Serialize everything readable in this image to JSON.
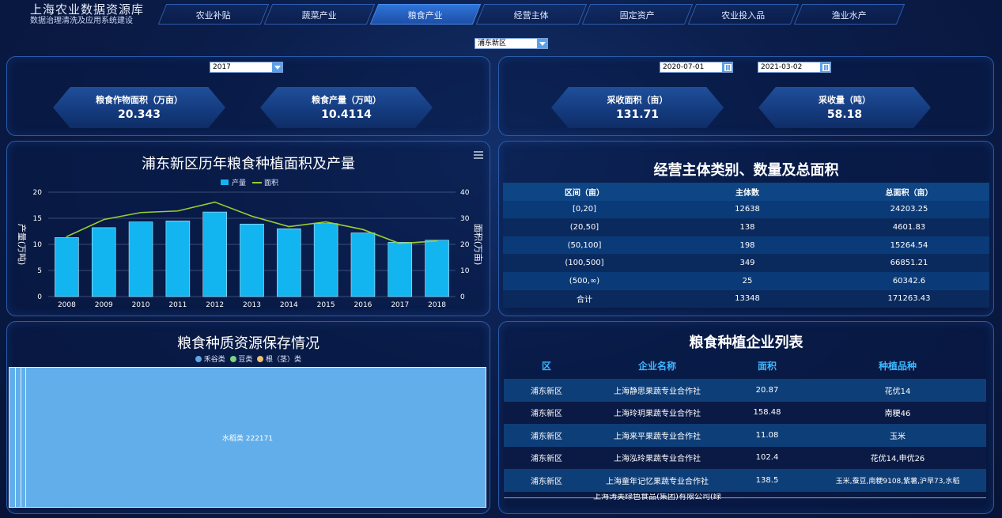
{
  "brand": {
    "title": "上海农业数据资源库",
    "subtitle": "数据治理清洗及应用系统建设"
  },
  "nav": {
    "tabs": [
      "农业补贴",
      "蔬菜产业",
      "粮食产业",
      "经营主体",
      "固定资产",
      "农业投入品",
      "渔业水产"
    ],
    "active": 2
  },
  "district_select": {
    "value": "浦东新区"
  },
  "year_select": {
    "value": "2017"
  },
  "date_from": {
    "value": "2020-07-01"
  },
  "date_to": {
    "value": "2021-03-02"
  },
  "kpis": [
    {
      "label": "粮食作物面积（万亩）",
      "value": "20.343"
    },
    {
      "label": "粮食产量（万吨）",
      "value": "10.4114"
    },
    {
      "label": "采收面积（亩）",
      "value": "131.71"
    },
    {
      "label": "采收量（吨）",
      "value": "58.18"
    }
  ],
  "chart_data": {
    "type": "bar",
    "title": "浦东新区历年粮食种植面积及产量",
    "categories": [
      "2008",
      "2009",
      "2010",
      "2011",
      "2012",
      "2013",
      "2014",
      "2015",
      "2016",
      "2017",
      "2018"
    ],
    "series": [
      {
        "name": "产量",
        "type": "bar",
        "axis": "left",
        "color": "#13b5f0",
        "values": [
          11.3,
          13.2,
          14.3,
          14.5,
          16.2,
          13.9,
          13.0,
          14.0,
          12.2,
          10.4,
          10.8
        ]
      },
      {
        "name": "面积",
        "type": "line",
        "axis": "right",
        "color": "#9acd32",
        "values": [
          23,
          29.5,
          32.2,
          32.8,
          36.2,
          30.8,
          26.8,
          28.6,
          25.7,
          20.3,
          21.3
        ]
      }
    ],
    "ylabel": "产量(万吨)",
    "y2label": "面积(万亩)",
    "ylim": [
      0,
      20
    ],
    "y2lim": [
      0,
      40
    ],
    "yticks": [
      "0",
      "5",
      "10",
      "15",
      "20"
    ],
    "y2ticks": [
      "0",
      "10",
      "20",
      "30",
      "40"
    ],
    "grid": true,
    "legend": "top-center"
  },
  "entities": {
    "title": "经营主体类别、数量及总面积",
    "headers": [
      "区间（亩）",
      "主体数",
      "总面积（亩）"
    ],
    "rows": [
      [
        "[0,20]",
        "12638",
        "24203.25"
      ],
      [
        "(20,50]",
        "138",
        "4601.83"
      ],
      [
        "(50,100]",
        "198",
        "15264.54"
      ],
      [
        "(100,500]",
        "349",
        "66851.21"
      ],
      [
        "(500,∞)",
        "25",
        "60342.6"
      ],
      [
        "合计",
        "13348",
        "171263.43"
      ]
    ]
  },
  "germplasm": {
    "title": "粮食种质资源保存情况",
    "legend": [
      {
        "name": "禾谷类",
        "color": "#5aa8ea"
      },
      {
        "name": "豆类",
        "color": "#7fd47f"
      },
      {
        "name": "根（茎）类",
        "color": "#f0c070"
      }
    ],
    "block_label": "水稻类  222171"
  },
  "companies": {
    "title": "粮食种植企业列表",
    "headers": [
      "区",
      "企业名称",
      "面积",
      "种植品种"
    ],
    "rows": [
      [
        "浦东新区",
        "上海静思果蔬专业合作社",
        "20.87",
        "花优14"
      ],
      [
        "浦东新区",
        "上海玲玥果蔬专业合作社",
        "158.48",
        "南粳46"
      ],
      [
        "浦东新区",
        "上海来平果蔬专业合作社",
        "11.08",
        "玉米"
      ],
      [
        "浦东新区",
        "上海泓玲果蔬专业合作社",
        "102.4",
        "花优14,申优26"
      ],
      [
        "浦东新区",
        "上海童年记忆果蔬专业合作社",
        "138.5",
        "玉米,蚕豆,南粳9108,紫薯,沪旱73,水稻"
      ]
    ],
    "partial_row": "上海涛美绿色食品(集团)有限公司(绿"
  }
}
